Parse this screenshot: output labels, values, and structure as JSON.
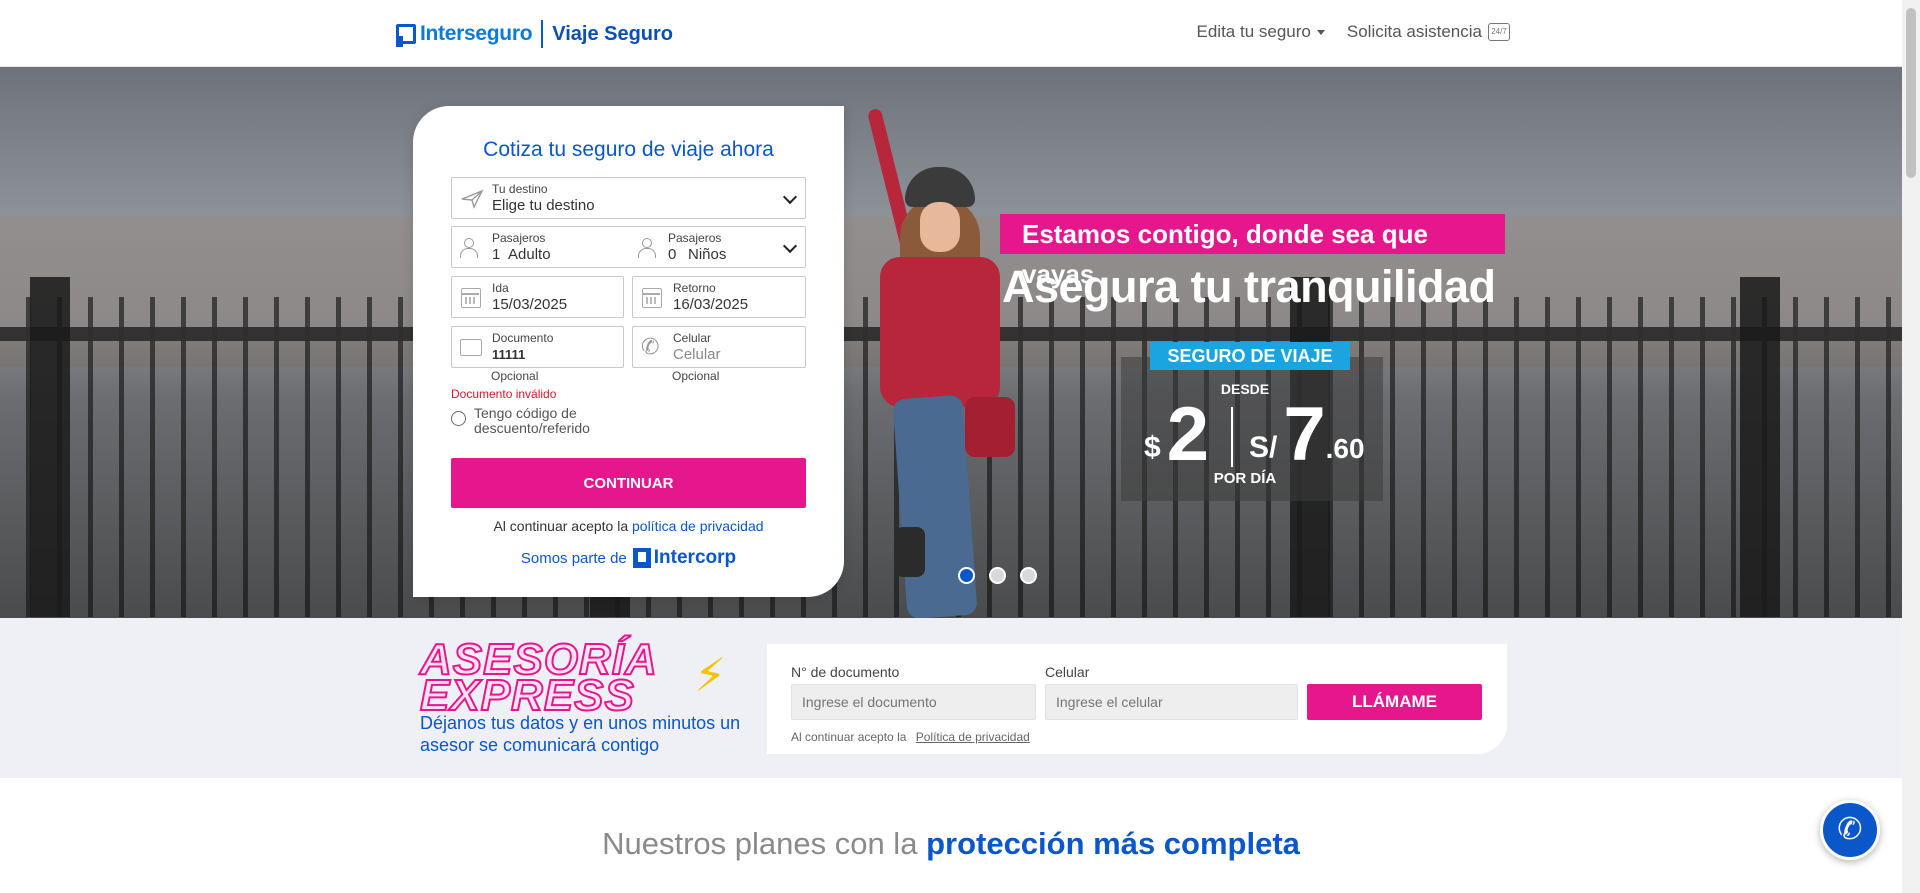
{
  "header": {
    "logo_brand": "Interseguro",
    "logo_product": "Viaje Seguro",
    "nav_edit": "Edita tu seguro",
    "nav_assist": "Solicita asistencia",
    "assist_icon": "chat-support-icon"
  },
  "hero": {
    "promo_tag": "Estamos contigo, donde sea que vayas",
    "promo_title": "Asegura tu tranquilidad",
    "badge_label": "SEGURO DE VIAJE",
    "desde": "DESDE",
    "price_usd_symbol": "$",
    "price_usd": "2",
    "price_pen_symbol": "S/",
    "price_pen": "7",
    "price_pen_decimal": ".60",
    "per_day": "POR DÍA",
    "carousel_active_index": 0,
    "carousel_count": 3
  },
  "quote_form": {
    "title": "Cotiza tu seguro de viaje ahora",
    "destination_label": "Tu destino",
    "destination_value": "Elige tu destino",
    "adults_label": "Pasajeros",
    "adults_count": "1",
    "adults_unit": "Adulto",
    "children_label": "Pasajeros",
    "children_count": "0",
    "children_unit": "Niños",
    "departure_label": "Ida",
    "departure_value": "15/03/2025",
    "return_label": "Retorno",
    "return_value": "16/03/2025",
    "document_label": "Documento",
    "document_value": "11111",
    "phone_label": "Celular",
    "phone_placeholder": "Celular",
    "optional_doc": "Opcional",
    "optional_phone": "Opcional",
    "error_document": "Documento inválido",
    "discount_label": "Tengo código de descuento/referido",
    "continue_button": "CONTINUAR",
    "privacy_prefix": "Al continuar acepto la",
    "privacy_link": "política de privacidad",
    "part_of": "Somos parte de",
    "group_brand": "Intercorp"
  },
  "asesoria": {
    "title_line1": "ASESORÍA",
    "title_line2": "EXPRESS",
    "subtitle": "Déjanos tus datos y en unos minutos un asesor se comunicará contigo",
    "doc_label": "N° de documento",
    "doc_placeholder": "Ingrese el documento",
    "phone_label": "Celular",
    "phone_placeholder": "Ingrese el celular",
    "call_button": "LLÁMAME",
    "privacy_prefix": "Al continuar acepto la",
    "privacy_link": "Política de privacidad"
  },
  "plans": {
    "title_prefix": "Nuestros planes con la",
    "title_highlight": "protección más completa"
  },
  "colors": {
    "brand_blue": "#0a57c9",
    "brand_pink": "#e6178d",
    "badge_cyan": "#1aa4e0",
    "error_red": "#e0122b"
  }
}
